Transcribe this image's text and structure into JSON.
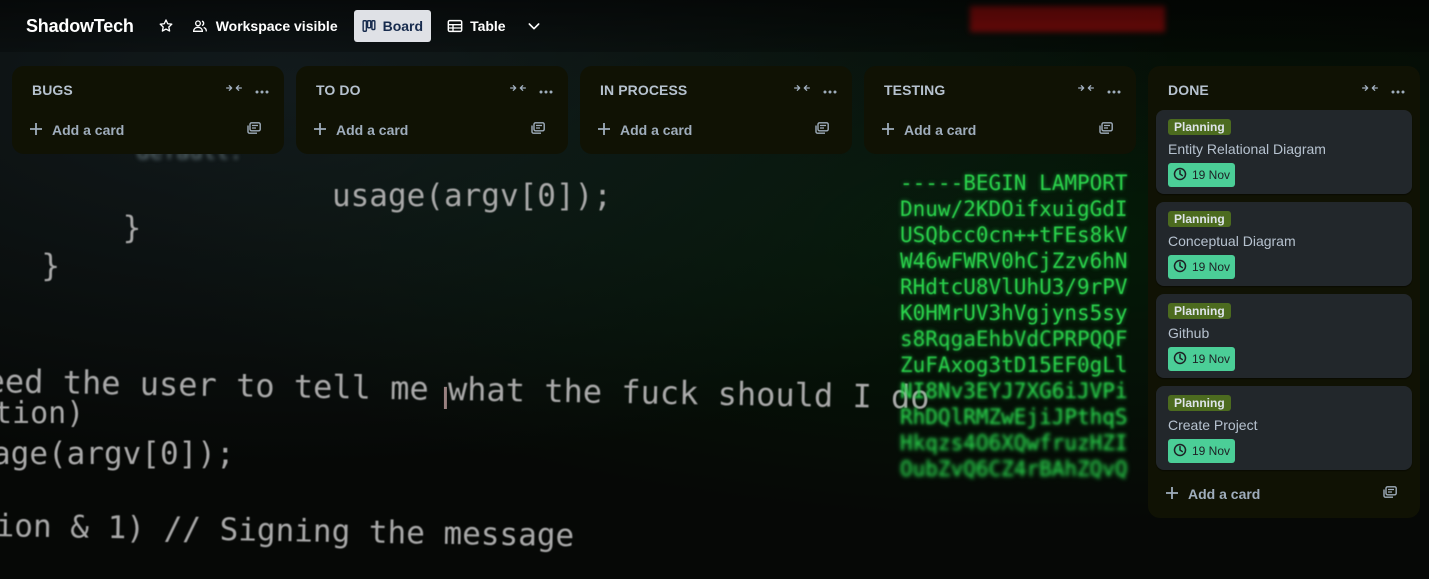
{
  "header": {
    "board_title": "ShadowTech",
    "visibility_label": "Workspace visible",
    "views": [
      {
        "label": "Board",
        "active": true
      },
      {
        "label": "Table",
        "active": false
      }
    ]
  },
  "lists": [
    {
      "title": "BUGS",
      "add_card_label": "Add a card",
      "cards": []
    },
    {
      "title": "TO DO",
      "add_card_label": "Add a card",
      "cards": []
    },
    {
      "title": "IN PROCESS",
      "add_card_label": "Add a card",
      "cards": []
    },
    {
      "title": "TESTING",
      "add_card_label": "Add a card",
      "cards": []
    },
    {
      "title": "DONE",
      "add_card_label": "Add a card",
      "cards": [
        {
          "label": "Planning",
          "title": "Entity Relational Diagram",
          "due": "19 Nov"
        },
        {
          "label": "Planning",
          "title": "Conceptual Diagram",
          "due": "19 Nov"
        },
        {
          "label": "Planning",
          "title": "Github",
          "due": "19 Nov"
        },
        {
          "label": "Planning",
          "title": "Create Project",
          "due": "19 Nov"
        }
      ]
    }
  ],
  "background": {
    "code_lines": [
      "      usage(argv[0]);",
      "    }",
      "  }",
      "eed the user to tell me what the fuck should I do",
      "tion)",
      "age(argv[0]);",
      "ion & 1) // Signing the message"
    ],
    "key_lines": [
      "-----BEGIN LAMPORT",
      "Dnuw/2KDOifxuigGdI",
      "USQbcc0cn++tFEs8kV",
      "W46wFWRV0hCjZzv6hN",
      "RHdtcU8VlUhU3/9rPV",
      "K0HMrUV3hVgjyns5sy",
      "s8RqgaEhbVdCPRPQQF",
      "ZuFAxog3tD15EF0gLl",
      "NI8Nv3EYJ7XG6iJVPi",
      "RhDQlRMZwEjiJPthqS",
      "Hkqzs4O6XQwfruzHZI",
      "OubZvQ6CZ4rBAhZQvQ"
    ]
  },
  "colors": {
    "list_bg": "#101204",
    "card_bg": "#22272b",
    "label_green": "#4c6b1f",
    "due_complete": "#4bce97",
    "active_view_bg": "#dfe1e6"
  },
  "icons": {
    "star": "star-icon",
    "visibility": "people-icon",
    "board": "board-icon",
    "table": "table-icon",
    "views_menu": "chevron-down-icon",
    "collapse": "collapse-icon",
    "menu": "more-horizontal-icon",
    "add": "plus-icon",
    "template": "card-template-icon",
    "due": "clock-icon"
  }
}
